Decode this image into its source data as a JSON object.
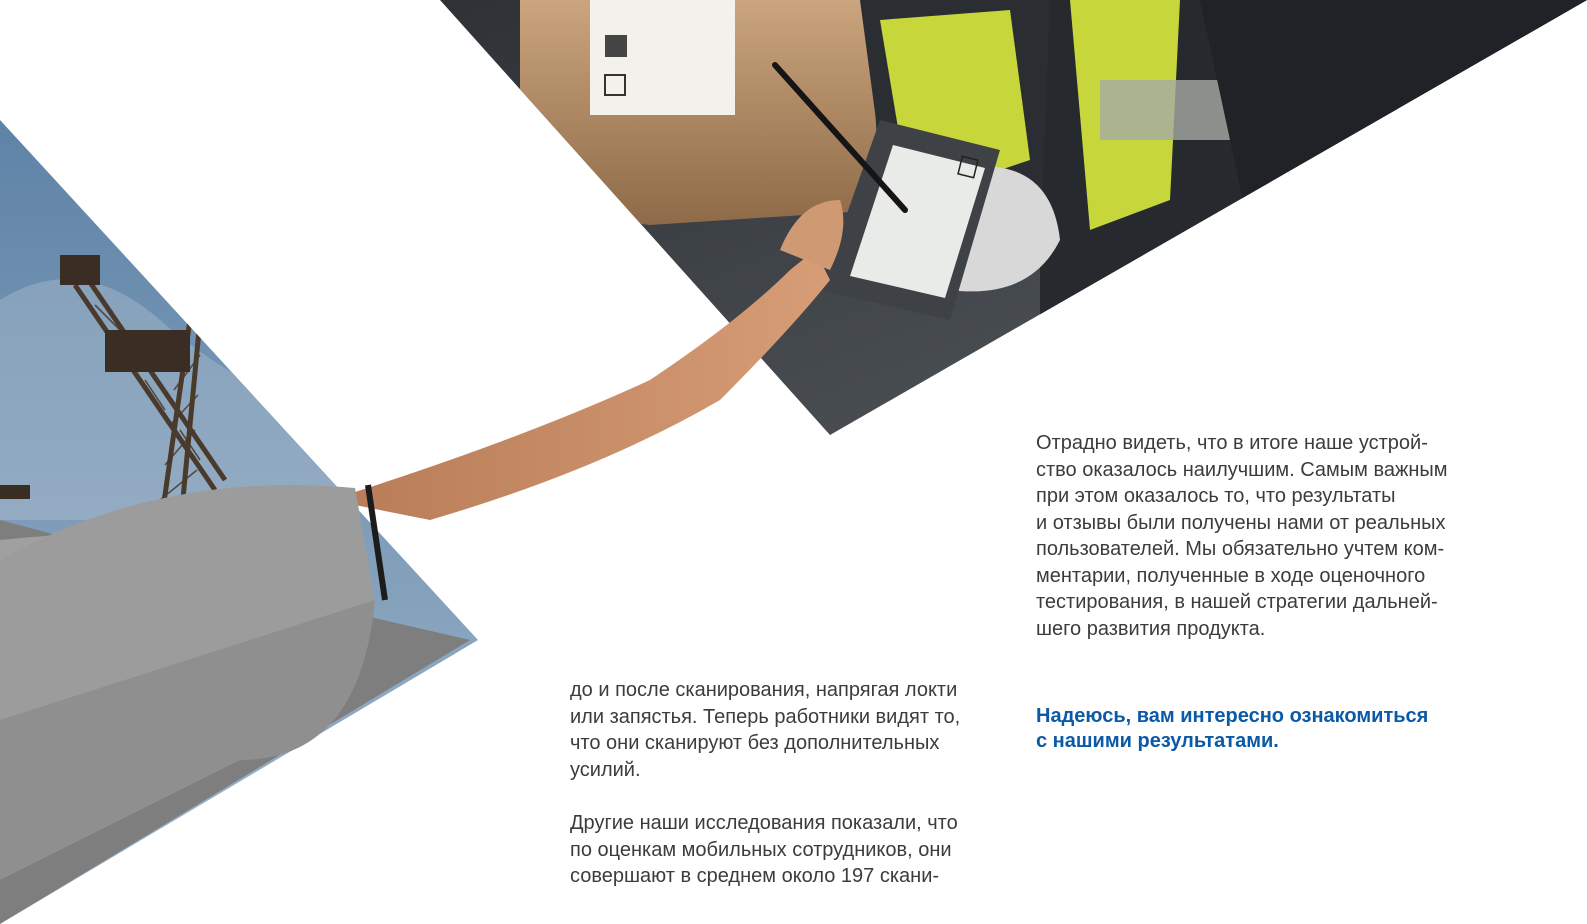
{
  "page": {
    "colors": {
      "background": "#ffffff",
      "body_text": "#3c3c3c",
      "accent_blue": "#0a5aa8",
      "sky": "#6f93b4",
      "crane": "#4a3a2c",
      "box": "#b08d66",
      "jacket": "#2c3136",
      "vest": "#c6d63b",
      "shirt": "#9c9c9c"
    }
  },
  "images": {
    "crane_photo": {
      "icon": "crane-sky-photo"
    },
    "delivery_photo": {
      "icon": "courier-signing-handheld-terminal-photo"
    },
    "arm_photo": {
      "icon": "arm-holding-stylus-photo"
    }
  },
  "right_column": {
    "paragraph": "Отрадно видеть, что в итоге наше устрой-\nство оказалось наилучшим. Самым важным\nпри этом оказалось то, что результаты\nи отзывы были получены нами от реальных\nпользователей. Мы обязательно учтем ком-\nментарии, полученные в ходе оценочного\nтестирования, в нашей стратегии дальней-\nшего развития продукта.",
    "closing": "Надеюсь, вам интересно ознакомиться\nс нашими результатами."
  },
  "middle_column": {
    "paragraph_1": "до и после сканирования, напрягая локти\nили запястья. Теперь работники видят то,\nчто они сканируют без дополнительных\nусилий.",
    "paragraph_2": "Другие наши исследования показали, что\nпо оценкам мобильных сотрудников, они\nсовершают в среднем около 197 скани-"
  }
}
